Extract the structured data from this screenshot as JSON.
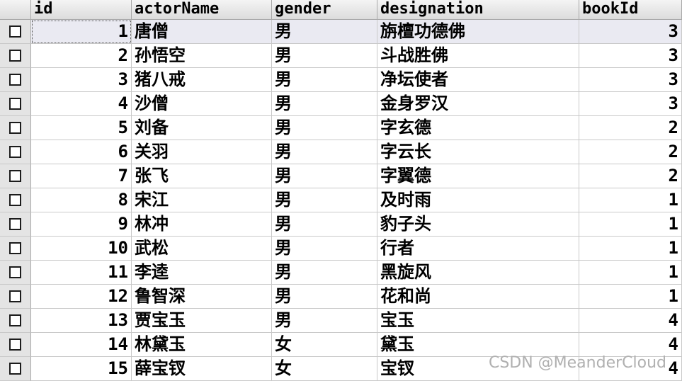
{
  "table": {
    "columns": [
      "id",
      "actorName",
      "gender",
      "designation",
      "bookId"
    ],
    "rows": [
      {
        "id": "1",
        "actorName": "唐僧",
        "gender": "男",
        "designation": "旃檀功德佛",
        "bookId": "3"
      },
      {
        "id": "2",
        "actorName": "孙悟空",
        "gender": "男",
        "designation": "斗战胜佛",
        "bookId": "3"
      },
      {
        "id": "3",
        "actorName": "猪八戒",
        "gender": "男",
        "designation": "净坛使者",
        "bookId": "3"
      },
      {
        "id": "4",
        "actorName": "沙僧",
        "gender": "男",
        "designation": "金身罗汉",
        "bookId": "3"
      },
      {
        "id": "5",
        "actorName": "刘备",
        "gender": "男",
        "designation": "字玄德",
        "bookId": "2"
      },
      {
        "id": "6",
        "actorName": "关羽",
        "gender": "男",
        "designation": "字云长",
        "bookId": "2"
      },
      {
        "id": "7",
        "actorName": "张飞",
        "gender": "男",
        "designation": "字翼德",
        "bookId": "2"
      },
      {
        "id": "8",
        "actorName": "宋江",
        "gender": "男",
        "designation": "及时雨",
        "bookId": "1"
      },
      {
        "id": "9",
        "actorName": "林冲",
        "gender": "男",
        "designation": "豹子头",
        "bookId": "1"
      },
      {
        "id": "10",
        "actorName": "武松",
        "gender": "男",
        "designation": "行者",
        "bookId": "1"
      },
      {
        "id": "11",
        "actorName": "李逵",
        "gender": "男",
        "designation": "黑旋风",
        "bookId": "1"
      },
      {
        "id": "12",
        "actorName": "鲁智深",
        "gender": "男",
        "designation": "花和尚",
        "bookId": "1"
      },
      {
        "id": "13",
        "actorName": "贾宝玉",
        "gender": "男",
        "designation": "宝玉",
        "bookId": "4"
      },
      {
        "id": "14",
        "actorName": "林黛玉",
        "gender": "女",
        "designation": "黛玉",
        "bookId": "4"
      },
      {
        "id": "15",
        "actorName": "薛宝钗",
        "gender": "女",
        "designation": "宝钗",
        "bookId": "4"
      }
    ]
  },
  "watermark": "CSDN @MeanderCloud"
}
